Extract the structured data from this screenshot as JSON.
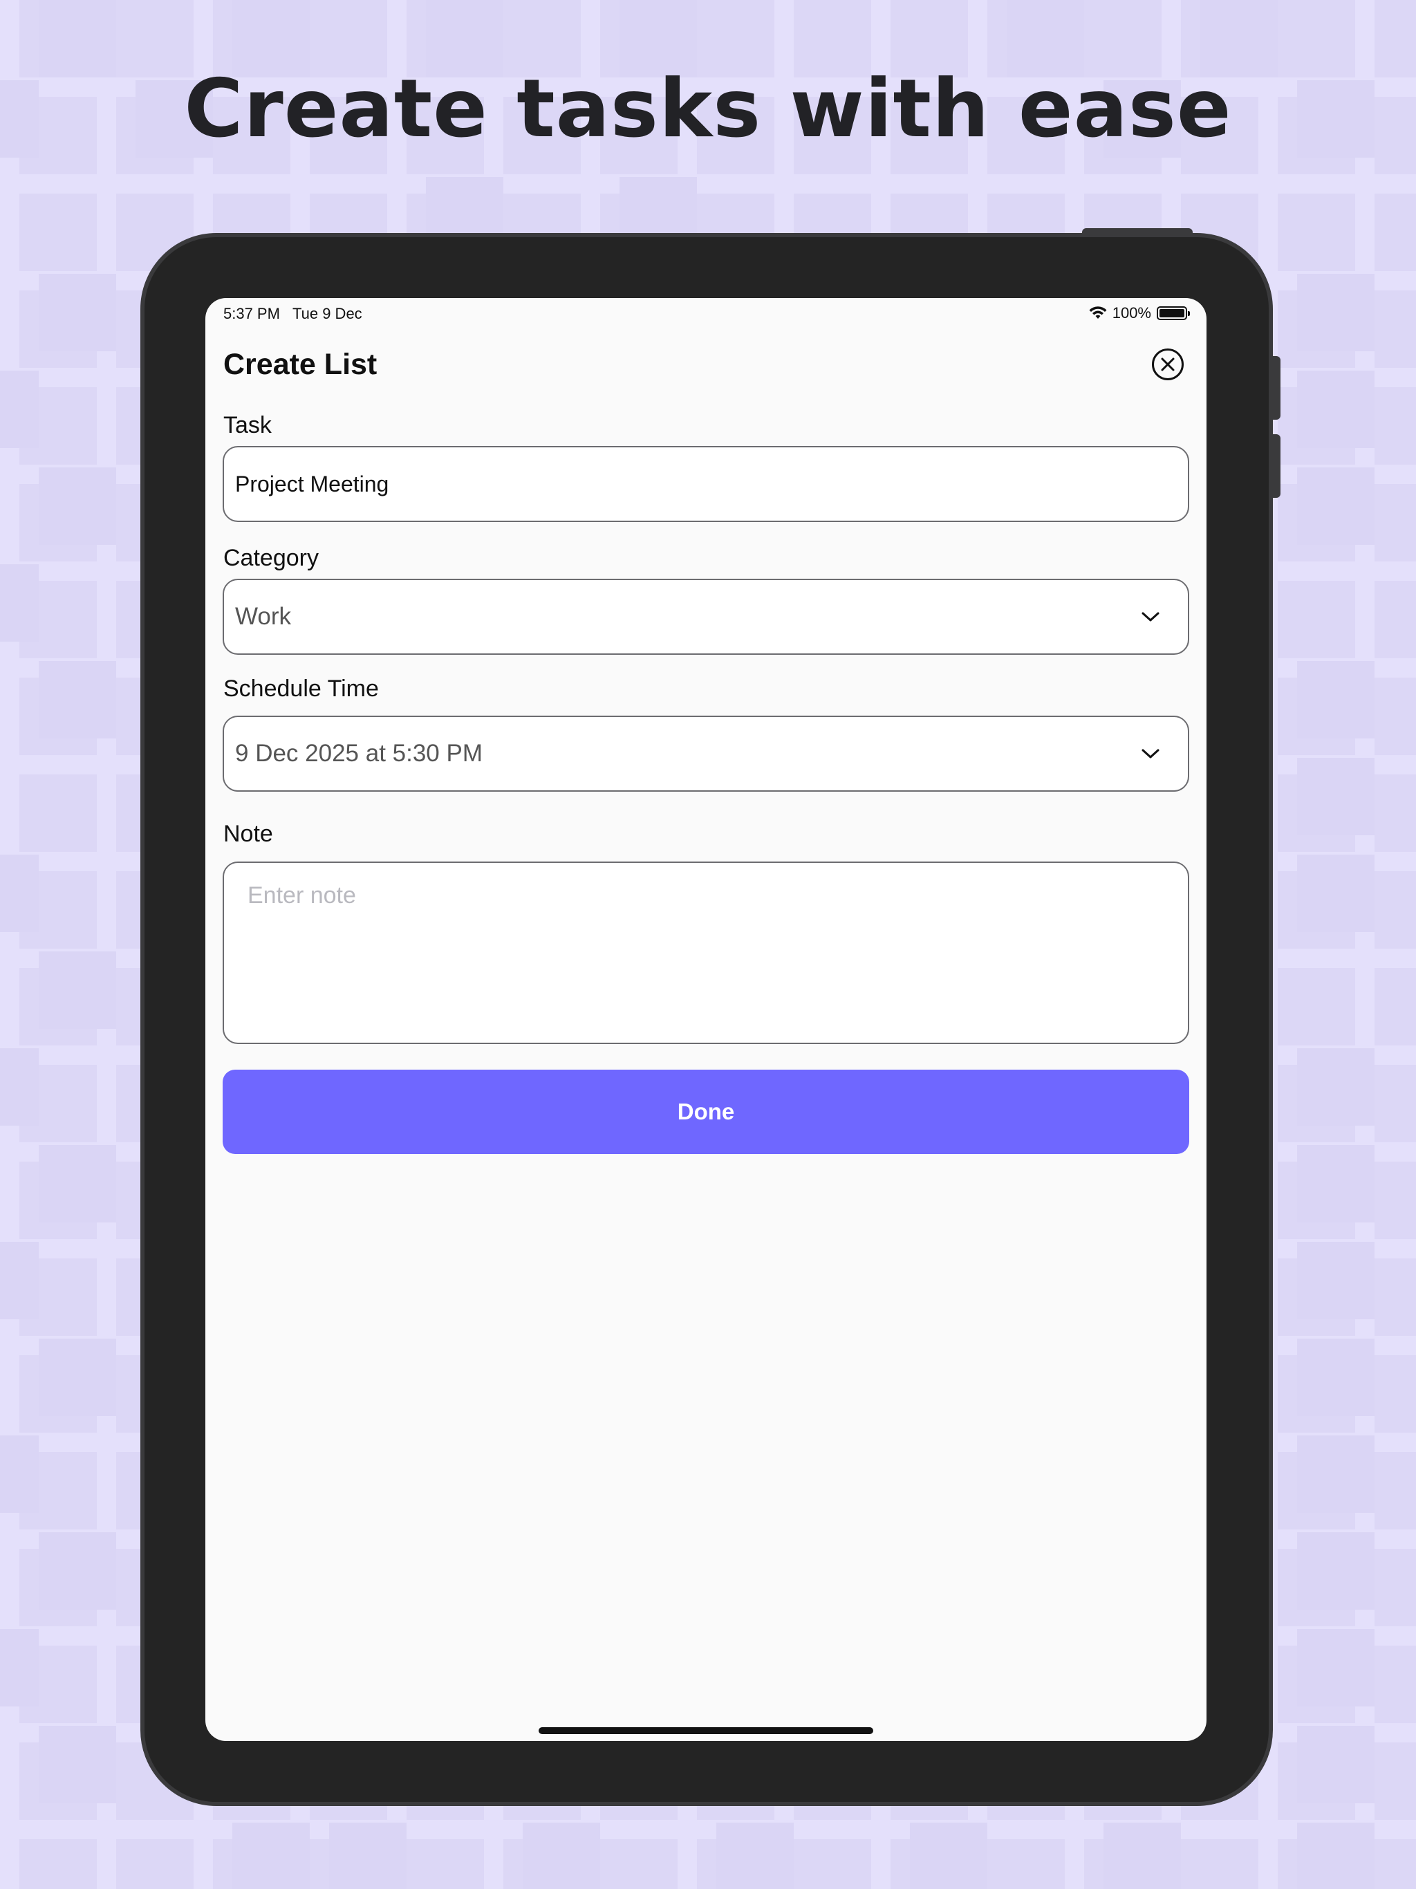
{
  "headline": "Create tasks with ease",
  "status_bar": {
    "time": "5:37 PM",
    "date": "Tue 9 Dec",
    "battery_text": "100%",
    "wifi_icon": "wifi-icon",
    "battery_icon": "battery-icon"
  },
  "form": {
    "title": "Create List",
    "close_icon": "close-circle-icon",
    "task": {
      "label": "Task",
      "value": "Project Meeting"
    },
    "category": {
      "label": "Category",
      "value": "Work",
      "icon": "chevron-down-icon"
    },
    "schedule": {
      "label": "Schedule Time",
      "value": "9 Dec 2025 at 5:30 PM",
      "icon": "chevron-down-icon"
    },
    "note": {
      "label": "Note",
      "placeholder": "Enter note"
    },
    "done_label": "Done"
  },
  "colors": {
    "background": "#e4e0fb",
    "device_frame": "#242424",
    "screen": "#fafafa",
    "accent": "#6f67ff",
    "headline_text": "#222226"
  }
}
